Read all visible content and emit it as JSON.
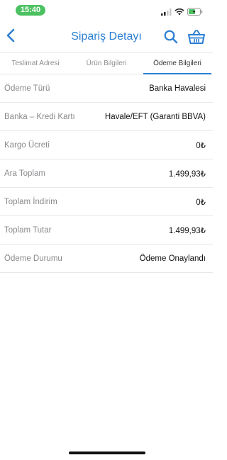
{
  "status_bar": {
    "time": "15:40"
  },
  "nav": {
    "title": "Sipariş Detayı"
  },
  "tabs": [
    {
      "label": "Teslimat Adresi",
      "active": false
    },
    {
      "label": "Ürün Bilgileri",
      "active": false
    },
    {
      "label": "Ödeme Bilgileri",
      "active": true
    }
  ],
  "details": [
    {
      "label": "Ödeme Türü",
      "value": "Banka Havalesi"
    },
    {
      "label": "Banka – Kredi Kartı",
      "value": "Havale/EFT (Garanti BBVA)"
    },
    {
      "label": "Kargo Ücreti",
      "value": "0₺"
    },
    {
      "label": "Ara Toplam",
      "value": "1.499,93₺"
    },
    {
      "label": "Toplam İndirim",
      "value": "0₺"
    },
    {
      "label": "Toplam Tutar",
      "value": "1.499,93₺"
    },
    {
      "label": "Ödeme Durumu",
      "value": "Ödeme Onaylandı"
    }
  ],
  "colors": {
    "accent": "#2d7fd3",
    "time_pill": "#4cc161"
  },
  "icons": [
    "back-chevron-icon",
    "search-icon",
    "basket-icon",
    "signal-icon",
    "wifi-icon",
    "battery-icon"
  ]
}
